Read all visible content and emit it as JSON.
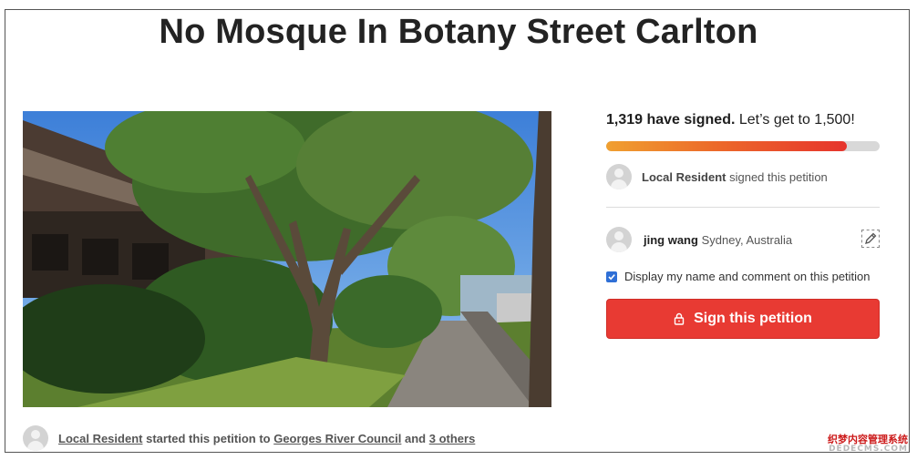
{
  "petition": {
    "title": "No Mosque In Botany Street Carlton"
  },
  "progress": {
    "signed_count": "1,319 have signed.",
    "goal_text": "Let’s get to 1,500!",
    "fraction": 0.88,
    "fill_color": "#e6342d"
  },
  "recent_signer": {
    "name": "Local Resident",
    "action": "signed this petition"
  },
  "current_user": {
    "name": "jing wang",
    "location": "Sydney, Australia",
    "edit_icon": "pencil-icon"
  },
  "display_option": {
    "label": "Display my name and comment on this petition",
    "checked": true
  },
  "sign_button": {
    "label": "Sign this petition",
    "icon": "lock-icon",
    "color": "#e83a33"
  },
  "starter": {
    "name": "Local Resident",
    "text_mid": "started this petition to",
    "target": "Georges River Council",
    "and": "and",
    "others": "3 others"
  },
  "watermark": {
    "line1": "织梦内容管理系统",
    "line2": "DEDECMS.COM"
  }
}
